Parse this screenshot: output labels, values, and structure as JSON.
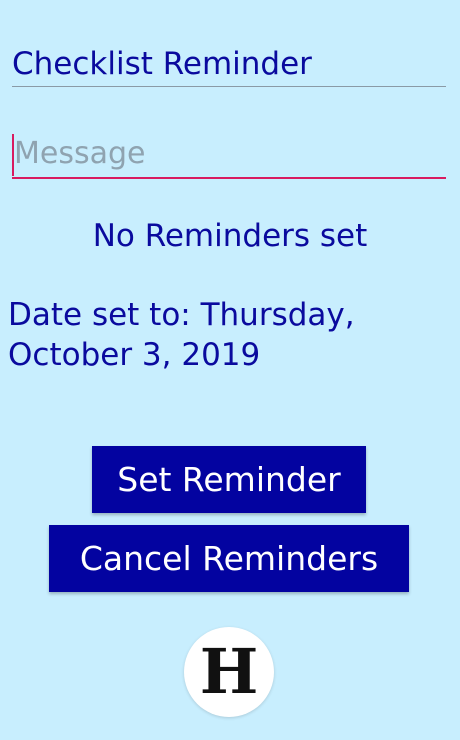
{
  "app": {
    "title": "Checklist Reminder"
  },
  "message_field": {
    "value": "",
    "placeholder": "Message"
  },
  "status": {
    "text": "No Reminders set"
  },
  "date": {
    "text": "Date set to: Thursday, October 3, 2019"
  },
  "buttons": {
    "set_reminder": "Set Reminder",
    "cancel_reminders": "Cancel Reminders"
  },
  "logo": {
    "letter": "H"
  },
  "colors": {
    "background": "#c8eefe",
    "text": "#0a0a9e",
    "button": "#0303a0",
    "accent": "#d81b60"
  }
}
